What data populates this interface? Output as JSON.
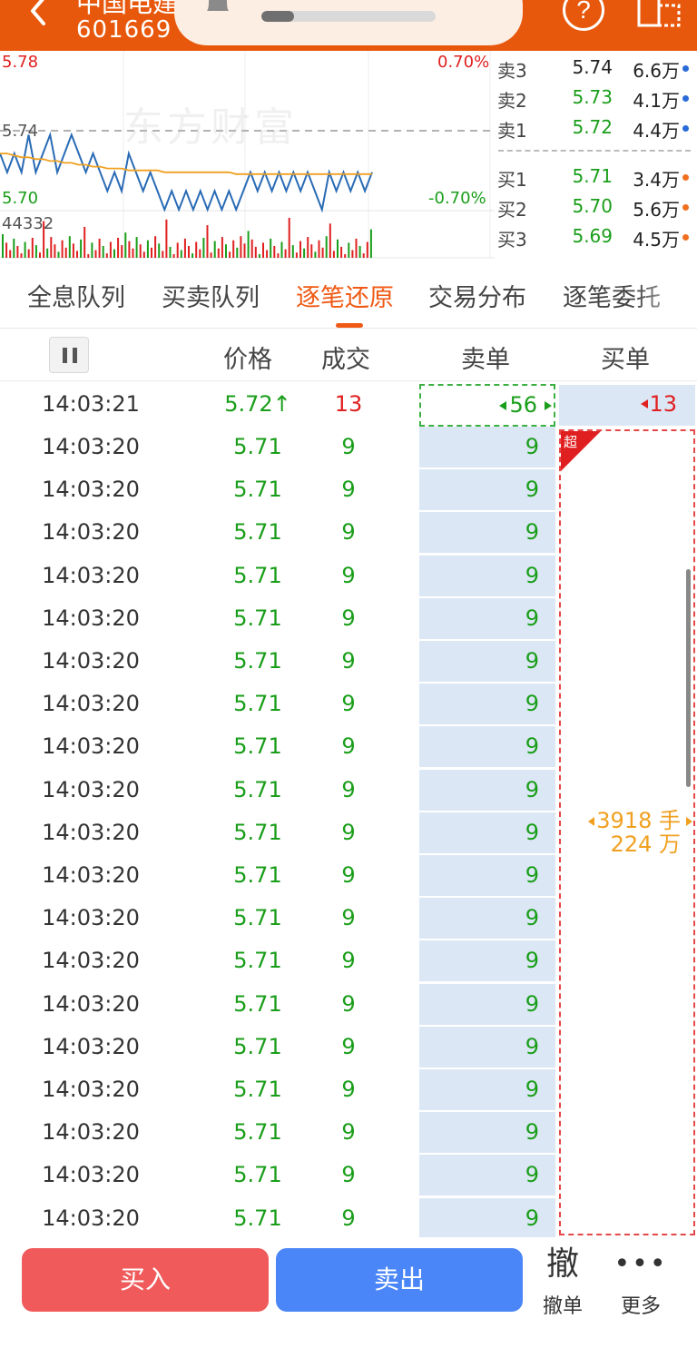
{
  "header": {
    "stock_name": "中国电建",
    "stock_code": "601669",
    "notification_progress": 0.19
  },
  "chart": {
    "price_high": "5.78",
    "price_ref": "5.74",
    "price_low": "5.70",
    "pct_high": "0.70%",
    "pct_low": "-0.70%",
    "volume_max": "44332",
    "watermark": "东方财富",
    "price_color": "#2a6bb5",
    "avg_color": "#f0a020"
  },
  "chart_data": {
    "type": "line",
    "ylim": [
      5.7,
      5.78
    ],
    "series": [
      {
        "values": [
          5.73,
          5.72,
          5.73,
          5.72,
          5.74,
          5.72,
          5.73,
          5.74,
          5.72,
          5.73,
          5.74,
          5.73,
          5.72,
          5.73,
          5.72,
          5.71,
          5.72,
          5.71,
          5.73,
          5.72,
          5.71,
          5.72,
          5.71,
          5.7,
          5.71,
          5.7,
          5.71,
          5.7,
          5.71,
          5.7,
          5.71,
          5.7,
          5.71,
          5.7,
          5.71,
          5.72,
          5.71,
          5.72,
          5.71,
          5.72,
          5.71,
          5.72,
          5.71,
          5.72,
          5.71,
          5.7,
          5.72,
          5.71,
          5.72,
          5.71,
          5.72,
          5.71,
          5.72
        ]
      },
      {
        "values": [
          5.73,
          5.73,
          5.729,
          5.728,
          5.728,
          5.727,
          5.727,
          5.726,
          5.726,
          5.725,
          5.725,
          5.724,
          5.724,
          5.723,
          5.723,
          5.722,
          5.722,
          5.722,
          5.721,
          5.721,
          5.721,
          5.721,
          5.721,
          5.72,
          5.72,
          5.72,
          5.72,
          5.72,
          5.72,
          5.72,
          5.72,
          5.72,
          5.72,
          5.719,
          5.719,
          5.719,
          5.719,
          5.719,
          5.719,
          5.719,
          5.719,
          5.719,
          5.719,
          5.719,
          5.719,
          5.719,
          5.719,
          5.719,
          5.719,
          5.719,
          5.719,
          5.719,
          5.719
        ]
      }
    ]
  },
  "orderbook": {
    "asks": [
      {
        "label": "卖3",
        "price": "5.74",
        "vol": "6.6万"
      },
      {
        "label": "卖2",
        "price": "5.73",
        "vol": "4.1万"
      },
      {
        "label": "卖1",
        "price": "5.72",
        "vol": "4.4万"
      }
    ],
    "bids": [
      {
        "label": "买1",
        "price": "5.71",
        "vol": "3.4万"
      },
      {
        "label": "买2",
        "price": "5.70",
        "vol": "5.6万"
      },
      {
        "label": "买3",
        "price": "5.69",
        "vol": "4.5万"
      }
    ],
    "ask_dot_color": "#2a6bd8",
    "bid_dot_color": "#f07020"
  },
  "tabs": [
    "全息队列",
    "买卖队列",
    "逐笔还原",
    "交易分布",
    "逐笔委托"
  ],
  "columns": {
    "price": "价格",
    "deal": "成交",
    "sell": "卖单",
    "buy": "买单"
  },
  "first_row": {
    "time": "14:03:21",
    "price": "5.72↑",
    "deal": "13",
    "sell": "56",
    "buy": "13"
  },
  "rows": [
    {
      "time": "14:03:20",
      "price": "5.71",
      "deal": "9",
      "sell": "9"
    },
    {
      "time": "14:03:20",
      "price": "5.71",
      "deal": "9",
      "sell": "9"
    },
    {
      "time": "14:03:20",
      "price": "5.71",
      "deal": "9",
      "sell": "9"
    },
    {
      "time": "14:03:20",
      "price": "5.71",
      "deal": "9",
      "sell": "9"
    },
    {
      "time": "14:03:20",
      "price": "5.71",
      "deal": "9",
      "sell": "9"
    },
    {
      "time": "14:03:20",
      "price": "5.71",
      "deal": "9",
      "sell": "9"
    },
    {
      "time": "14:03:20",
      "price": "5.71",
      "deal": "9",
      "sell": "9"
    },
    {
      "time": "14:03:20",
      "price": "5.71",
      "deal": "9",
      "sell": "9"
    },
    {
      "time": "14:03:20",
      "price": "5.71",
      "deal": "9",
      "sell": "9"
    },
    {
      "time": "14:03:20",
      "price": "5.71",
      "deal": "9",
      "sell": "9"
    },
    {
      "time": "14:03:20",
      "price": "5.71",
      "deal": "9",
      "sell": "9"
    },
    {
      "time": "14:03:20",
      "price": "5.71",
      "deal": "9",
      "sell": "9"
    },
    {
      "time": "14:03:20",
      "price": "5.71",
      "deal": "9",
      "sell": "9"
    },
    {
      "time": "14:03:20",
      "price": "5.71",
      "deal": "9",
      "sell": "9"
    },
    {
      "time": "14:03:20",
      "price": "5.71",
      "deal": "9",
      "sell": "9"
    },
    {
      "time": "14:03:20",
      "price": "5.71",
      "deal": "9",
      "sell": "9"
    },
    {
      "time": "14:03:20",
      "price": "5.71",
      "deal": "9",
      "sell": "9"
    },
    {
      "time": "14:03:20",
      "price": "5.71",
      "deal": "9",
      "sell": "9"
    },
    {
      "time": "14:03:20",
      "price": "5.71",
      "deal": "9",
      "sell": "9"
    }
  ],
  "big_order": {
    "tag": "超",
    "lots": "3918 手",
    "amount": "224 万"
  },
  "bottom": {
    "buy": "买入",
    "sell": "卖出",
    "cancel_icon": "撤",
    "cancel": "撤单",
    "more": "更多"
  },
  "colors": {
    "up": "#e02020",
    "down": "#1a9e1a",
    "brand": "#e8580c"
  }
}
